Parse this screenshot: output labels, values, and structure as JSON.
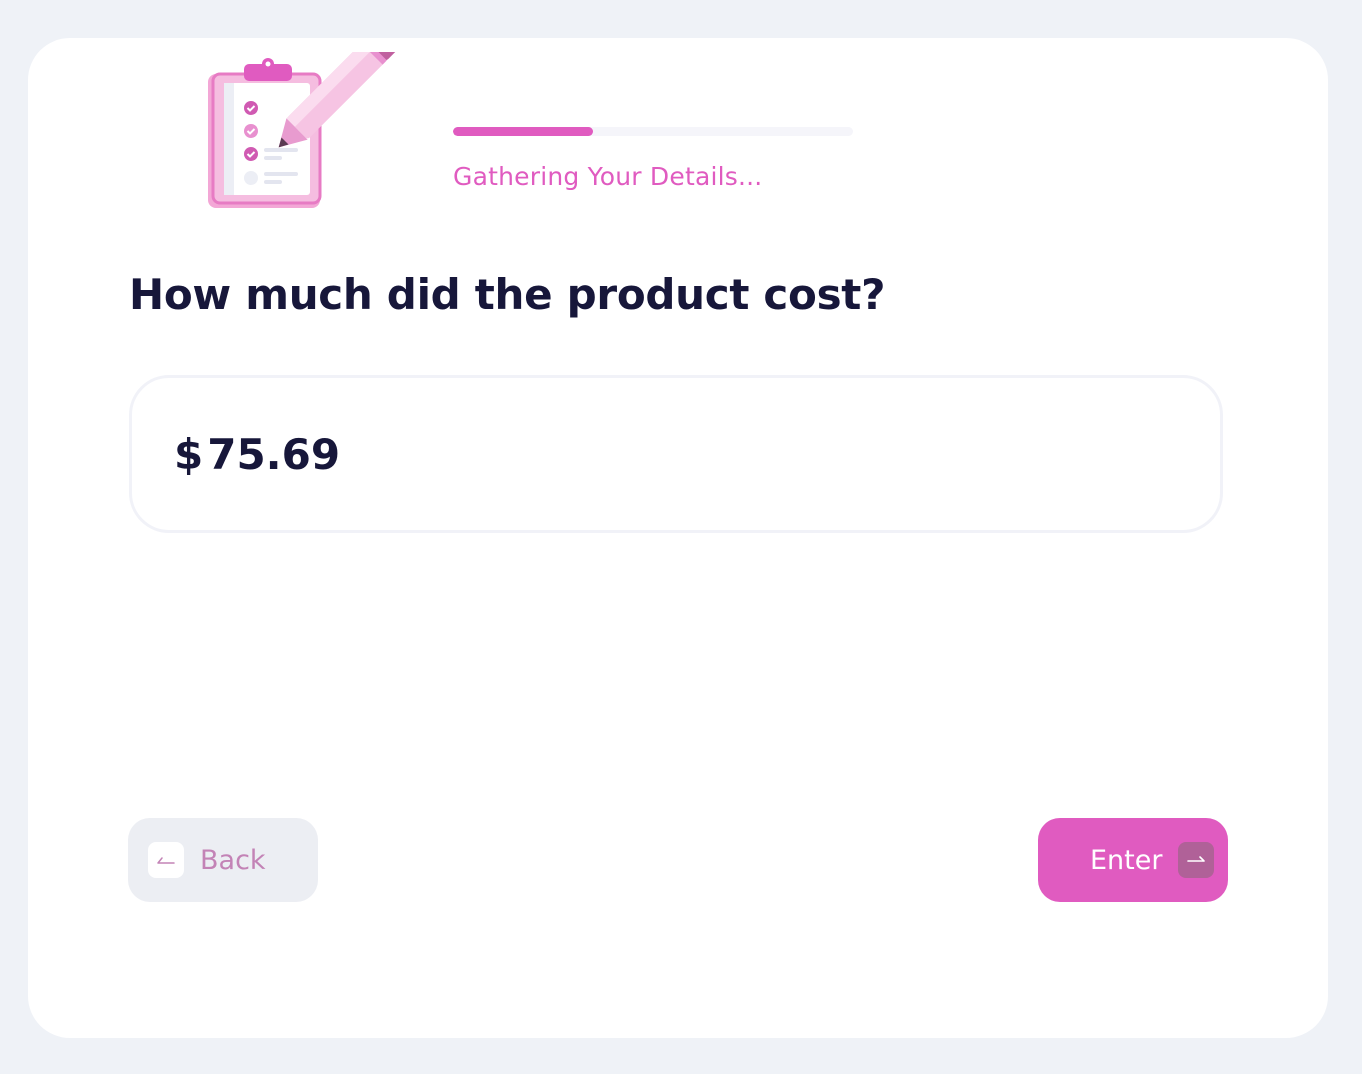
{
  "header": {
    "progress_label": "Gathering Your Details...",
    "progress_fraction": 0.35
  },
  "illustration": {
    "icon": "clipboard-pencil-illustration"
  },
  "question": {
    "title": "How much did the product cost?"
  },
  "amount_field": {
    "currency_symbol": "$",
    "value": "75.69"
  },
  "navigation": {
    "back_label": "Back",
    "enter_label": "Enter",
    "back_icon": "back-arrow-icon",
    "enter_icon": "enter-arrow-icon"
  },
  "colors": {
    "accent": "#e05bc0",
    "accent_dark": "#b06198",
    "text_dark": "#17173a",
    "page_background": "#eff2f7"
  }
}
